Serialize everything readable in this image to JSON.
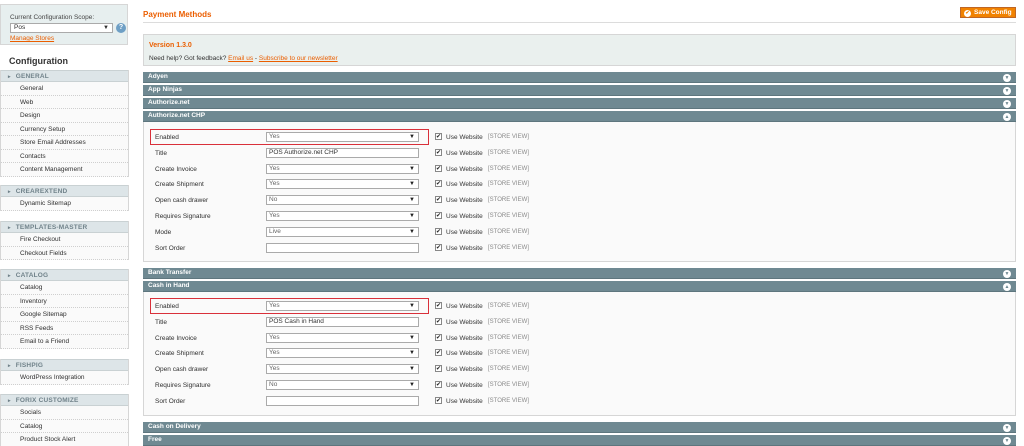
{
  "sidebar": {
    "scope_label": "Current Configuration Scope:",
    "scope_value": "Pos",
    "manage_stores": "Manage Stores",
    "title": "Configuration",
    "sections": [
      {
        "name": "GENERAL",
        "items": [
          "General",
          "Web",
          "Design",
          "Currency Setup",
          "Store Email Addresses",
          "Contacts",
          "Content Management"
        ]
      },
      {
        "name": "CREAREXTEND",
        "items": [
          "Dynamic Sitemap"
        ]
      },
      {
        "name": "TEMPLATES-MASTER",
        "items": [
          "Fire Checkout",
          "Checkout Fields"
        ]
      },
      {
        "name": "CATALOG",
        "items": [
          "Catalog",
          "Inventory",
          "Google Sitemap",
          "RSS Feeds",
          "Email to a Friend"
        ]
      },
      {
        "name": "FISHPIG",
        "items": [
          "WordPress Integration"
        ]
      },
      {
        "name": "FORIX CUSTOMIZE",
        "items": [
          "Socials",
          "Catalog",
          "Product Stock Alert"
        ]
      }
    ]
  },
  "main": {
    "title": "Payment Methods",
    "save_button": "Save Config",
    "version": "Version 1.3.0",
    "help_text": "Need help? Got feedback?",
    "email_link": "Email us",
    "separator": " - ",
    "newsletter_link": "Subscribe to our newsletter",
    "use_website": "Use Website",
    "store_view": "[STORE VIEW]",
    "collapsed_sections": [
      "Adyen",
      "App Ninjas",
      "Authorize.net",
      "Bank Transfer",
      "Cash on Delivery",
      "Free"
    ],
    "chp": {
      "title": "Authorize.net CHP",
      "fields": [
        {
          "label": "Enabled",
          "value": "Yes"
        },
        {
          "label": "Title",
          "value": "POS Authorize.net CHP"
        },
        {
          "label": "Create Invoice",
          "value": "Yes"
        },
        {
          "label": "Create Shipment",
          "value": "Yes"
        },
        {
          "label": "Open cash drawer",
          "value": "No"
        },
        {
          "label": "Requires Signature",
          "value": "Yes"
        },
        {
          "label": "Mode",
          "value": "Live"
        },
        {
          "label": "Sort Order",
          "value": ""
        }
      ]
    },
    "cash": {
      "title": "Cash in Hand",
      "fields": [
        {
          "label": "Enabled",
          "value": "Yes"
        },
        {
          "label": "Title",
          "value": "POS Cash in Hand"
        },
        {
          "label": "Create Invoice",
          "value": "Yes"
        },
        {
          "label": "Create Shipment",
          "value": "Yes"
        },
        {
          "label": "Open cash drawer",
          "value": "Yes"
        },
        {
          "label": "Requires Signature",
          "value": "No"
        },
        {
          "label": "Sort Order",
          "value": ""
        }
      ]
    }
  }
}
